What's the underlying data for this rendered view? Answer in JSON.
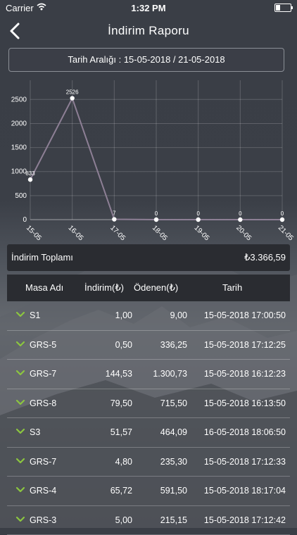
{
  "status": {
    "carrier": "Carrier",
    "time": "1:32 PM"
  },
  "nav": {
    "title": "İndirim Raporu"
  },
  "date_range": "Tarih Aralığı : 15-05-2018  /  21-05-2018",
  "chart_data": {
    "type": "line",
    "x": [
      "15-05",
      "16-05",
      "17-05",
      "18-05",
      "19-05",
      "20-05",
      "21-05"
    ],
    "values": [
      833,
      2526,
      7,
      0,
      0,
      0,
      0
    ],
    "data_labels": [
      "833",
      "2526",
      "7",
      "0",
      "0",
      "0",
      "0"
    ],
    "y_ticks": [
      "0",
      "500",
      "1000",
      "1500",
      "2000",
      "2500"
    ],
    "ylim": [
      0,
      2900
    ],
    "grid": true,
    "line_color": "#8d7f95",
    "point_color": "#ffffff"
  },
  "summary": {
    "label": "İndirim Toplamı",
    "value": "₺3.366,59"
  },
  "table": {
    "headers": {
      "masa": "Masa Adı",
      "indirim": "İndirim(₺)",
      "odenen": "Ödenen(₺)",
      "tarih": "Tarih"
    },
    "rows": [
      {
        "masa": "S1",
        "indirim": "1,00",
        "odenen": "9,00",
        "tarih": "15-05-2018 17:00:50"
      },
      {
        "masa": "GRS-5",
        "indirim": "0,50",
        "odenen": "336,25",
        "tarih": "15-05-2018 17:12:25"
      },
      {
        "masa": "GRS-7",
        "indirim": "144,53",
        "odenen": "1.300,73",
        "tarih": "15-05-2018 16:12:23"
      },
      {
        "masa": "GRS-8",
        "indirim": "79,50",
        "odenen": "715,50",
        "tarih": "15-05-2018 16:13:50"
      },
      {
        "masa": "S3",
        "indirim": "51,57",
        "odenen": "464,09",
        "tarih": "16-05-2018 18:06:50"
      },
      {
        "masa": "GRS-7",
        "indirim": "4,80",
        "odenen": "235,30",
        "tarih": "15-05-2018 17:12:33"
      },
      {
        "masa": "GRS-4",
        "indirim": "65,72",
        "odenen": "591,50",
        "tarih": "15-05-2018 18:17:04"
      },
      {
        "masa": "GRS-3",
        "indirim": "5,00",
        "odenen": "215,15",
        "tarih": "15-05-2018 17:12:42"
      }
    ]
  },
  "colors": {
    "chevron": "#8cc63f",
    "header_bg": "#2a2c31"
  },
  "icons": {
    "back": "chevron-left-icon",
    "row_expand": "chevron-down-icon",
    "wifi": "wifi-icon",
    "battery": "battery-icon"
  }
}
